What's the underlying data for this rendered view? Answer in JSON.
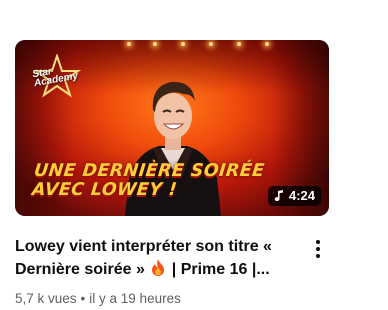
{
  "video": {
    "thumbnail": {
      "logo_text": "Star Academy",
      "overlay_title": "UNE DERNIÈRE SOIRÉE\nAVEC LOWEY !",
      "duration": "4:24",
      "duration_icon": "music-note-icon"
    },
    "title_part1": "Lowey vient interpréter son titre « Dernière soirée »",
    "title_icon": "fire-emoji",
    "title_part2": "| Prime 16 |...",
    "views": "5,7 k vues",
    "separator": "•",
    "age": "il y a 19 heures",
    "menu_icon": "more-vert-icon"
  },
  "colors": {
    "title": "#0f0f0f",
    "meta": "#606060",
    "overlay_text": "#ffcf3a",
    "background": "#ffffff"
  }
}
